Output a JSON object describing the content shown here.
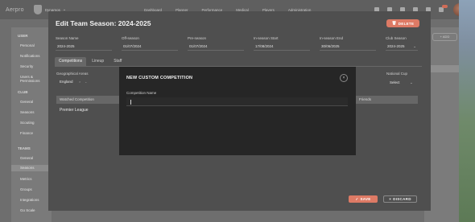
{
  "app": {
    "brand": "Aerpro",
    "team_name": "Dynamos",
    "nav": [
      "Dashboard",
      "Planner",
      "Performance",
      "Medical",
      "Players",
      "Administration"
    ]
  },
  "sidebar": {
    "sections": [
      {
        "title": "USER",
        "items": [
          "Personal",
          "Notifications",
          "Security",
          "Users & Permissions"
        ]
      },
      {
        "title": "CLUB",
        "items": [
          "General",
          "Seasons",
          "Scouting",
          "Finance"
        ]
      },
      {
        "title": "TEAMS",
        "items": [
          "General",
          "Seasons",
          "Metrics",
          "Groups",
          "Integrations",
          "Go Scale"
        ]
      }
    ],
    "active_item": "Seasons"
  },
  "background": {
    "add_button": "+ ADD"
  },
  "panel": {
    "title": "Edit Team Season: 2024-2025",
    "delete_label": "DELETE",
    "fields": [
      {
        "label": "Season Name",
        "value": "2024-2025"
      },
      {
        "label": "Off-season",
        "value": "01/07/2024"
      },
      {
        "label": "Pre-season",
        "value": "01/07/2024"
      },
      {
        "label": "In-season Start",
        "value": "17/08/2024"
      },
      {
        "label": "In-season End",
        "value": "30/06/2025"
      },
      {
        "label": "Club Season",
        "value": "2024-2025"
      }
    ],
    "tabs": [
      "Competitions",
      "Lineup",
      "Staff"
    ],
    "active_tab": "Competitions",
    "geo_label": "Geographical Areas",
    "geo_value": "England",
    "national_cup_label": "National Cup",
    "national_cup_value": "Select",
    "table_headers": [
      "Watched Competition",
      "Friends"
    ],
    "rows": [
      "Premier League"
    ],
    "save_label": "SAVE",
    "discard_label": "DISCARD"
  },
  "modal": {
    "title": "NEW CUSTOM COMPETITION",
    "field_label": "Competition Name",
    "field_value": "",
    "field_placeholder": ""
  },
  "colors": {
    "accent": "#dd7a65",
    "panel_bg": "#4f4f4f",
    "modal_bg": "#262626"
  }
}
